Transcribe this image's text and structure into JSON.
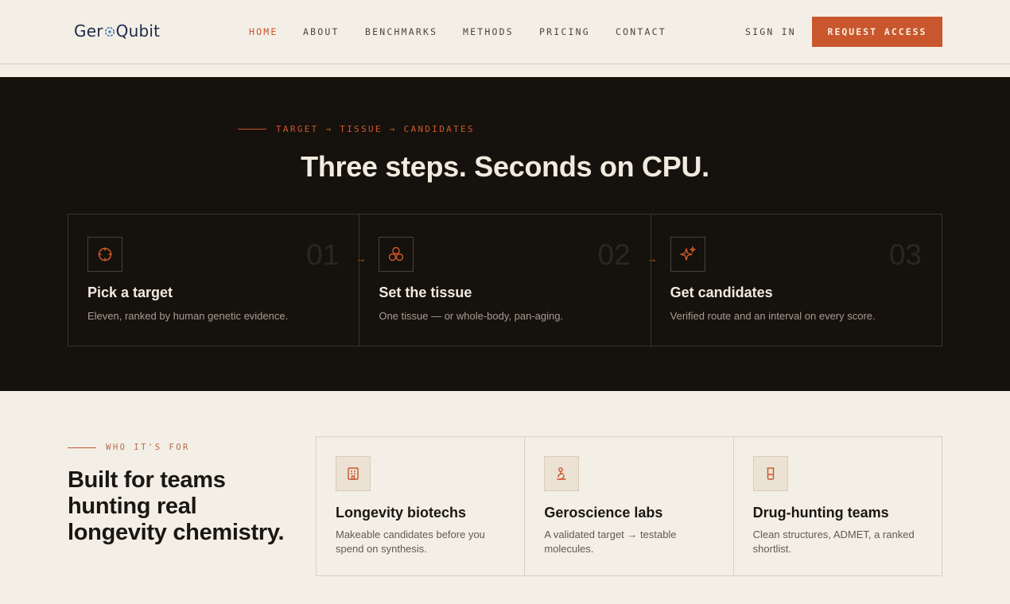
{
  "brand": {
    "name_part1": "Ger",
    "name_part2": "Qubit",
    "accent_color": "#c9562c",
    "logo_color": "#1f2a4a"
  },
  "nav": {
    "items": [
      "HOME",
      "ABOUT",
      "BENCHMARKS",
      "METHODS",
      "PRICING",
      "CONTACT"
    ],
    "active": "HOME",
    "sign_in": "SIGN IN",
    "cta": "REQUEST ACCESS"
  },
  "hero": {
    "eyebrow": "TARGET → TISSUE → CANDIDATES",
    "title": "Three steps. Seconds on CPU.",
    "steps": [
      {
        "num": "01",
        "title": "Pick a target",
        "desc": "Eleven, ranked by human genetic evidence.",
        "icon": "crosshair-icon"
      },
      {
        "num": "02",
        "title": "Set the tissue",
        "desc": "One tissue — or whole-body, pan-aging.",
        "icon": "cells-icon"
      },
      {
        "num": "03",
        "title": "Get candidates",
        "desc": "Verified route and an interval on every score.",
        "icon": "sparkle-icon"
      }
    ],
    "arrow": "→"
  },
  "audience": {
    "eyebrow": "WHO IT'S FOR",
    "title": "Built for teams hunting real longevity chemistry.",
    "cards": [
      {
        "title": "Longevity biotechs",
        "desc": "Makeable candidates before you spend on synthesis.",
        "icon": "building-icon"
      },
      {
        "title": "Geroscience labs",
        "desc": "A validated target → testable molecules.",
        "icon": "microscope-icon"
      },
      {
        "title": "Drug-hunting teams",
        "desc": "Clean structures, ADMET, a ranked shortlist.",
        "icon": "beaker-icon"
      }
    ]
  }
}
